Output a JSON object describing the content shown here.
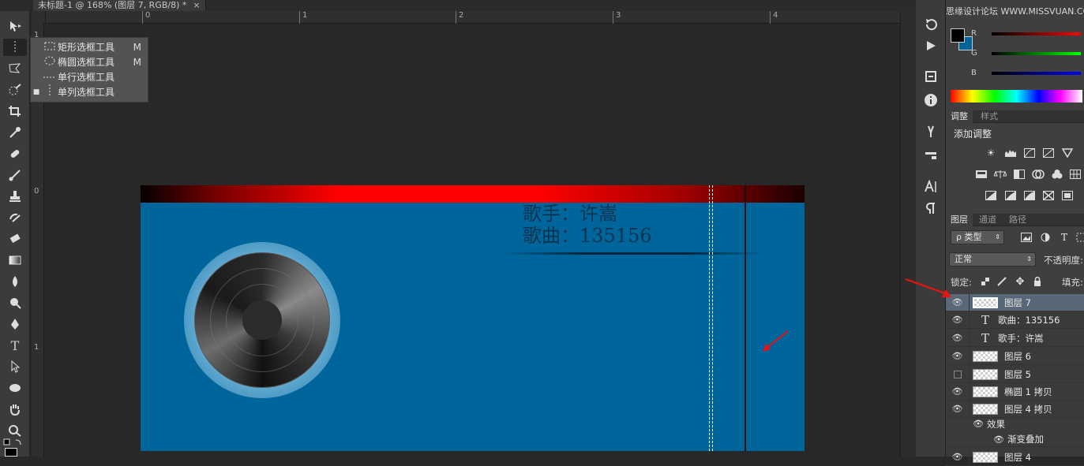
{
  "document": {
    "tab_title": "未标题-1 @ 168% (图层 7, RGB/8) *",
    "close_glyph": "×"
  },
  "toolbar": {
    "tools": [
      "move-tool",
      "marquee-tool",
      "lasso-tool",
      "quick-select-tool",
      "crop-tool",
      "eyedropper-tool",
      "healing-brush-tool",
      "brush-tool",
      "clone-stamp-tool",
      "history-brush-tool",
      "eraser-tool",
      "gradient-tool",
      "blur-tool",
      "dodge-tool",
      "pen-tool",
      "type-tool",
      "path-select-tool",
      "shape-tool",
      "hand-tool",
      "zoom-tool"
    ],
    "type_tool_glyph": "T"
  },
  "rulers": {
    "top": [
      "0",
      "1",
      "2",
      "3",
      "4"
    ],
    "left": [
      "1",
      "0",
      "1"
    ]
  },
  "flyout": {
    "items": [
      {
        "label": "矩形选框工具",
        "key": "M",
        "active": false
      },
      {
        "label": "椭圆选框工具",
        "key": "M",
        "active": false
      },
      {
        "label": "单行选框工具",
        "key": "",
        "active": false
      },
      {
        "label": "单列选框工具",
        "key": "",
        "active": true
      }
    ]
  },
  "artwork": {
    "singer_line": "歌手：许嵩",
    "song_line": "歌曲：135156"
  },
  "watermark": "思缘设计论坛 WWW.MISSVUAN.COM",
  "color_panel": {
    "channels": [
      "R",
      "G",
      "B"
    ],
    "foreground": "#000000",
    "background": "#00659a"
  },
  "adjustments": {
    "tabs": [
      "调整",
      "样式"
    ],
    "heading": "添加调整"
  },
  "layers_panel": {
    "tabs": [
      "图层",
      "通道",
      "路径"
    ],
    "filter_label": "ρ 类型",
    "blend_mode": "正常",
    "opacity_label": "不透明度:",
    "lock_label": "锁定:",
    "fill_label": "填充:",
    "layers": [
      {
        "name": "图层 7",
        "kind": "pixel",
        "visible": true,
        "selected": true
      },
      {
        "name": "歌曲：135156",
        "kind": "text",
        "visible": true,
        "selected": false
      },
      {
        "name": "歌手：许嵩",
        "kind": "text",
        "visible": true,
        "selected": false
      },
      {
        "name": "图层 6",
        "kind": "pixel",
        "visible": true,
        "selected": false
      },
      {
        "name": "图层 5",
        "kind": "pixel",
        "visible": false,
        "selected": false
      },
      {
        "name": "椭圆 1 拷贝",
        "kind": "pixel",
        "visible": true,
        "selected": false
      },
      {
        "name": "图层 4 拷贝",
        "kind": "pixel",
        "visible": true,
        "selected": false
      },
      {
        "name": "效果",
        "kind": "effect",
        "visible": true,
        "selected": false
      },
      {
        "name": "渐变叠加",
        "kind": "effect-item",
        "visible": true,
        "selected": false
      },
      {
        "name": "图层 4",
        "kind": "pixel",
        "visible": true,
        "selected": false
      }
    ]
  },
  "colors": {
    "canvas": "#00659a",
    "accent": "#ff0000",
    "selected_layer": "#596878"
  }
}
